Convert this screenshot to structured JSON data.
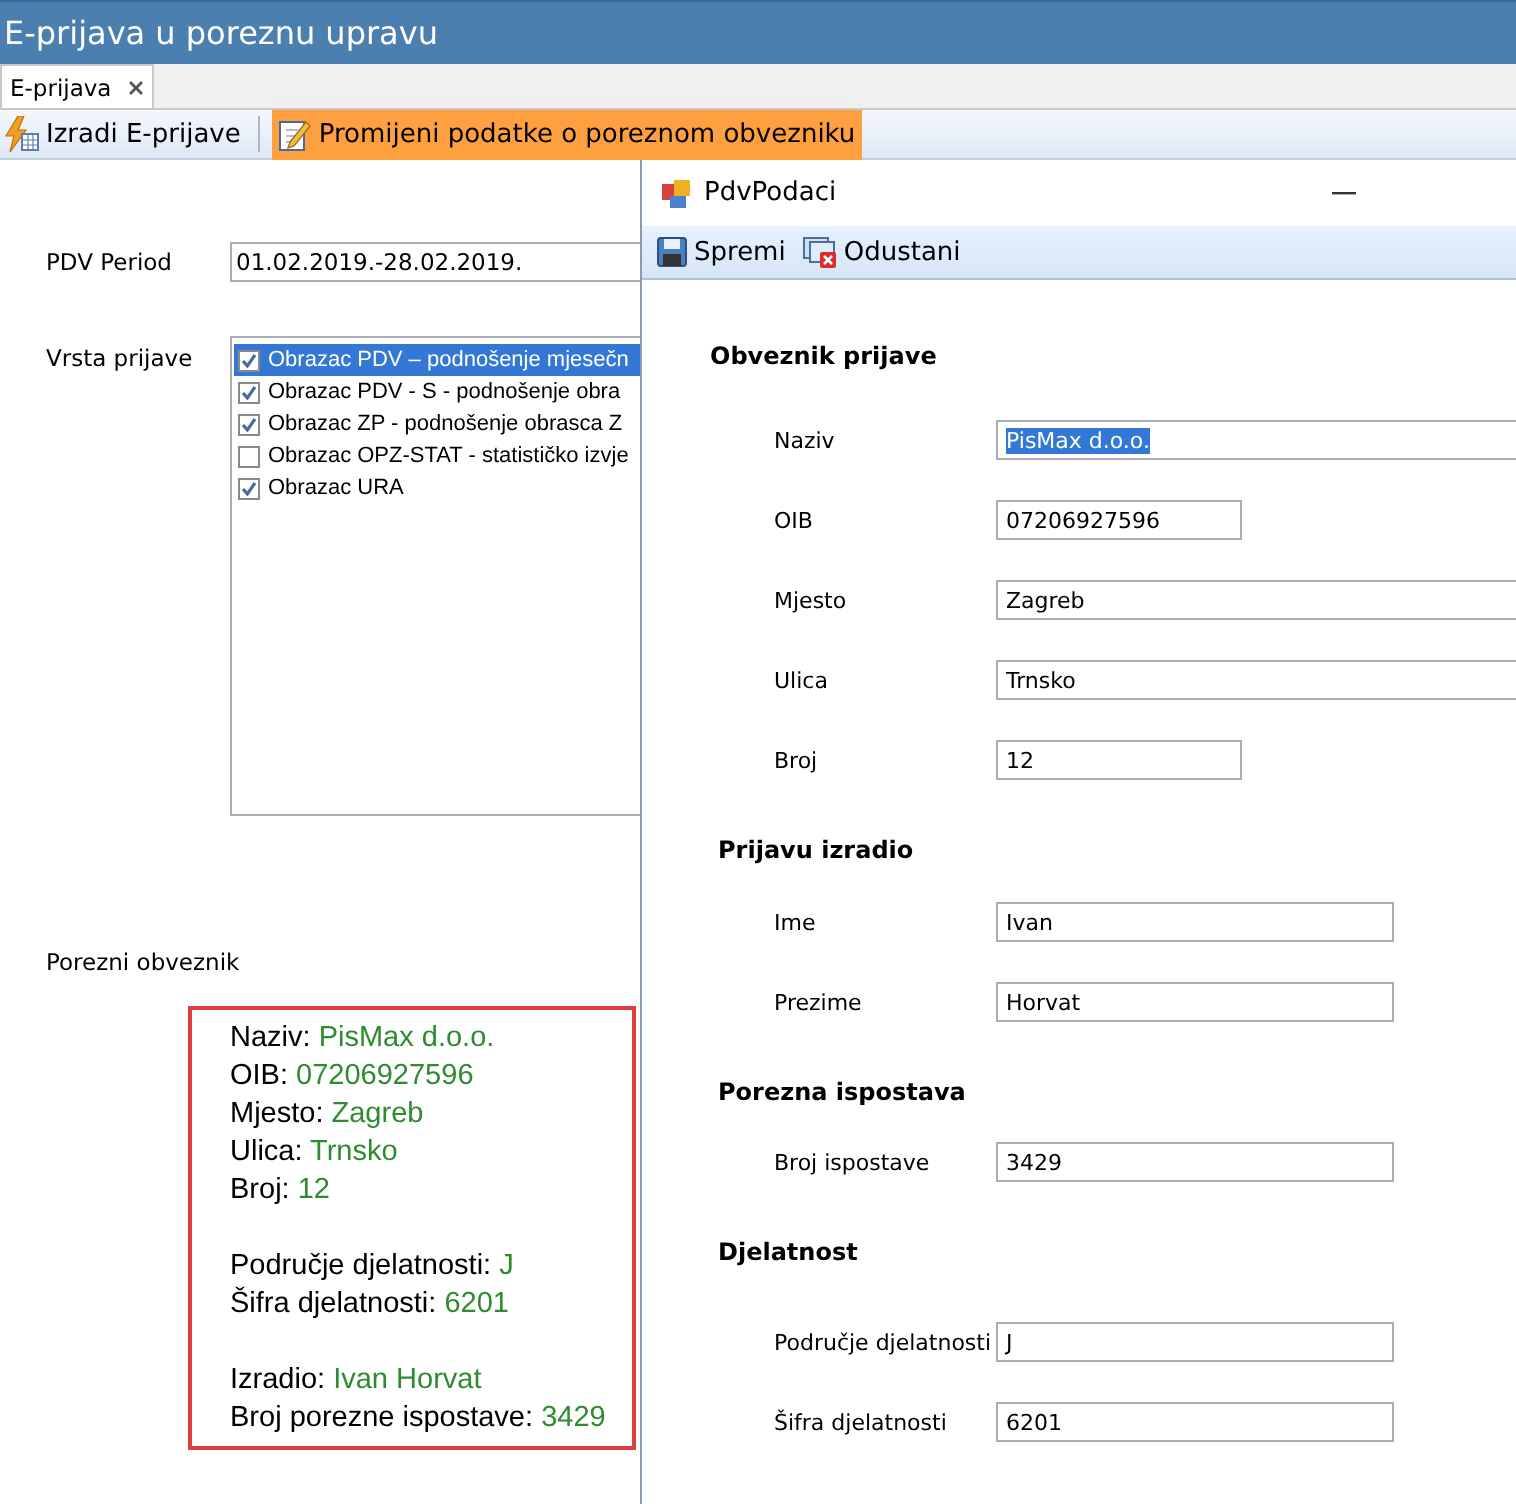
{
  "window": {
    "title": "E-prijava u poreznu upravu"
  },
  "tabs": [
    {
      "label": "E-prijava",
      "selected": true
    }
  ],
  "toolbar": [
    {
      "label": "Izradi E-prijave",
      "kind": "create",
      "active": false
    },
    {
      "label": "Promijeni podatke o poreznom obvezniku",
      "kind": "edit",
      "active": true
    }
  ],
  "form": {
    "period_label": "PDV Period",
    "period_value": "01.02.2019.-28.02.2019.",
    "type_label": "Vrsta prijave",
    "types": [
      {
        "label": "Obrazac PDV – podnošenje mjesečn",
        "checked": true,
        "selected": true
      },
      {
        "label": "Obrazac PDV - S - podnošenje obra",
        "checked": true,
        "selected": false
      },
      {
        "label": "Obrazac ZP - podnošenje obrasca Z",
        "checked": true,
        "selected": false
      },
      {
        "label": "Obrazac OPZ-STAT - statističko izvje",
        "checked": false,
        "selected": false
      },
      {
        "label": "Obrazac URA",
        "checked": true,
        "selected": false
      }
    ],
    "taxpayer_label": "Porezni obveznik",
    "summary": [
      [
        {
          "label": "Naziv:",
          "value": "PisMax d.o.o."
        },
        {
          "label": "OIB:",
          "value": "07206927596"
        },
        {
          "label": "Mjesto:",
          "value": "Zagreb"
        },
        {
          "label": "Ulica:",
          "value": "Trnsko"
        },
        {
          "label": "Broj:",
          "value": "12"
        }
      ],
      [
        {
          "label": "Područje djelatnosti:",
          "value": "J"
        },
        {
          "label": "Šifra djelatnosti:",
          "value": "6201"
        }
      ],
      [
        {
          "label": "Izradio:",
          "value": "Ivan Horvat"
        },
        {
          "label": "Broj porezne ispostave:",
          "value": "3429"
        }
      ]
    ]
  },
  "dialog": {
    "title": "PdvPodaci",
    "toolbar": [
      {
        "label": "Spremi",
        "kind": "save"
      },
      {
        "label": "Odustani",
        "kind": "cancel"
      }
    ],
    "sections": [
      {
        "title": "Obveznik prijave",
        "fields": [
          {
            "label": "Naziv",
            "value": "PisMax d.o.o.",
            "kind": "wide",
            "text_selected": true
          },
          {
            "label": "OIB",
            "value": "07206927596",
            "kind": "short",
            "text_selected": false
          },
          {
            "label": "Mjesto",
            "value": "Zagreb",
            "kind": "wide",
            "text_selected": false
          },
          {
            "label": "Ulica",
            "value": "Trnsko",
            "kind": "wide",
            "text_selected": false
          },
          {
            "label": "Broj",
            "value": "12",
            "kind": "short",
            "text_selected": false
          }
        ]
      },
      {
        "title": "Prijavu izradio",
        "fields": [
          {
            "label": "Ime",
            "value": "Ivan",
            "kind": "medium",
            "text_selected": false
          },
          {
            "label": "Prezime",
            "value": "Horvat",
            "kind": "medium",
            "text_selected": false
          }
        ]
      },
      {
        "title": "Porezna ispostava",
        "fields": [
          {
            "label": "Broj ispostave",
            "value": "3429",
            "kind": "medium",
            "text_selected": false
          }
        ]
      },
      {
        "title": "Djelatnost",
        "fields": [
          {
            "label": "Područje djelatnosti",
            "value": "J",
            "kind": "medium",
            "text_selected": false
          },
          {
            "label": "Šifra djelatnosti",
            "value": "6201",
            "kind": "medium",
            "text_selected": false
          }
        ]
      }
    ]
  }
}
